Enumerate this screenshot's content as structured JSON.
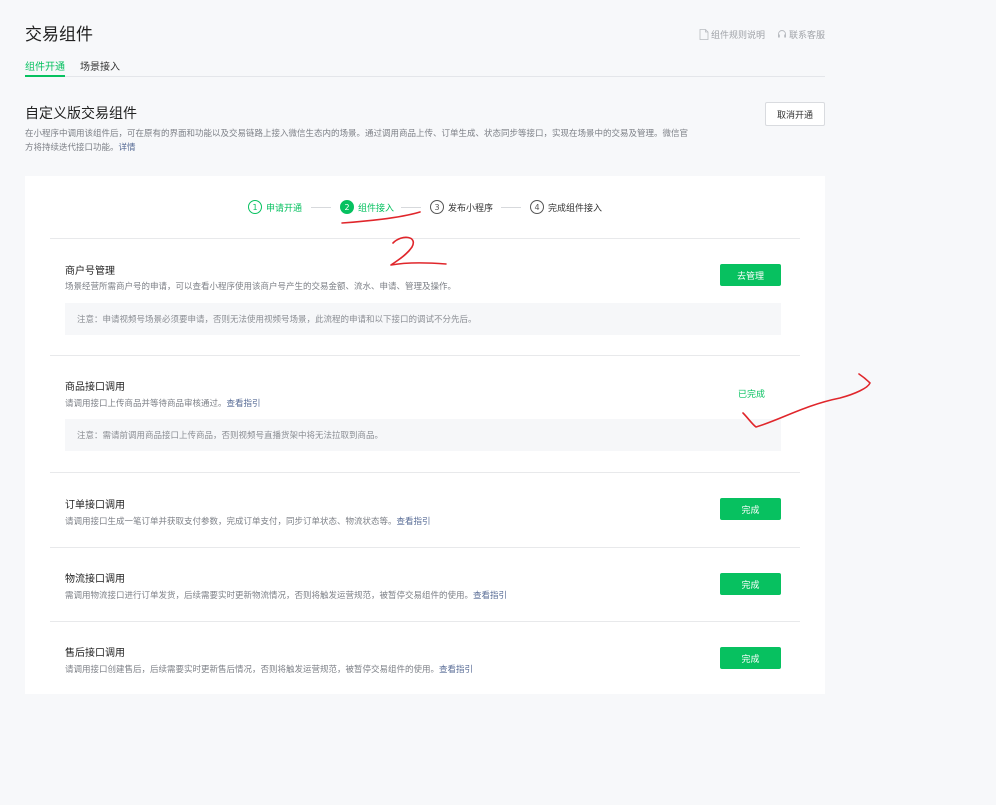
{
  "header": {
    "title": "交易组件",
    "links": [
      {
        "label": "组件规则说明",
        "icon": "document-icon"
      },
      {
        "label": "联系客服",
        "icon": "headset-icon"
      }
    ],
    "tabs": [
      {
        "label": "组件开通",
        "active": true
      },
      {
        "label": "场景接入",
        "active": false
      }
    ]
  },
  "section": {
    "title": "自定义版交易组件",
    "description": "在小程序中调用该组件后，可在原有的界面和功能以及交易链路上接入微信生态内的场景。通过调用商品上传、订单生成、状态同步等接口，实现在场景中的交易及管理。微信官方将持续迭代接口功能。",
    "detail_link": "详情",
    "cancel_button": "取消开通"
  },
  "steps": [
    {
      "num": "1",
      "label": "申请开通",
      "state": "done"
    },
    {
      "num": "2",
      "label": "组件接入",
      "state": "current"
    },
    {
      "num": "3",
      "label": "发布小程序",
      "state": "todo"
    },
    {
      "num": "4",
      "label": "完成组件接入",
      "state": "todo"
    }
  ],
  "rows": [
    {
      "title": "商户号管理",
      "desc": "场景经营所需商户号的申请，可以查看小程序使用该商户号产生的交易金额、流水、申请、管理及操作。",
      "link": "",
      "note": "注意：申请视频号场景必须要申请，否则无法使用视频号场景，此流程的申请和以下接口的调试不分先后。",
      "action": "去管理",
      "action_type": "button"
    },
    {
      "title": "商品接口调用",
      "desc": "请调用接口上传商品并等待商品审核通过。",
      "link": "查看指引",
      "note": "注意：需请前调用商品接口上传商品，否则视频号直播货架中将无法拉取到商品。",
      "action": "已完成",
      "action_type": "text"
    },
    {
      "title": "订单接口调用",
      "desc": "请调用接口生成一笔订单并获取支付参数，完成订单支付，同步订单状态、物流状态等。",
      "link": "查看指引",
      "note": "",
      "action": "完成",
      "action_type": "button"
    },
    {
      "title": "物流接口调用",
      "desc": "需调用物流接口进行订单发货，后续需要实时更新物流情况，否则将触发运营规范，被暂停交易组件的使用。",
      "link": "查看指引",
      "note": "",
      "action": "完成",
      "action_type": "button"
    },
    {
      "title": "售后接口调用",
      "desc": "请调用接口创建售后，后续需要实时更新售后情况，否则将触发运营规范，被暂停交易组件的使用。",
      "link": "查看指引",
      "note": "",
      "action": "完成",
      "action_type": "button"
    }
  ],
  "colors": {
    "accent": "#07c160",
    "link": "#576b95",
    "annotation": "#e0262b"
  }
}
